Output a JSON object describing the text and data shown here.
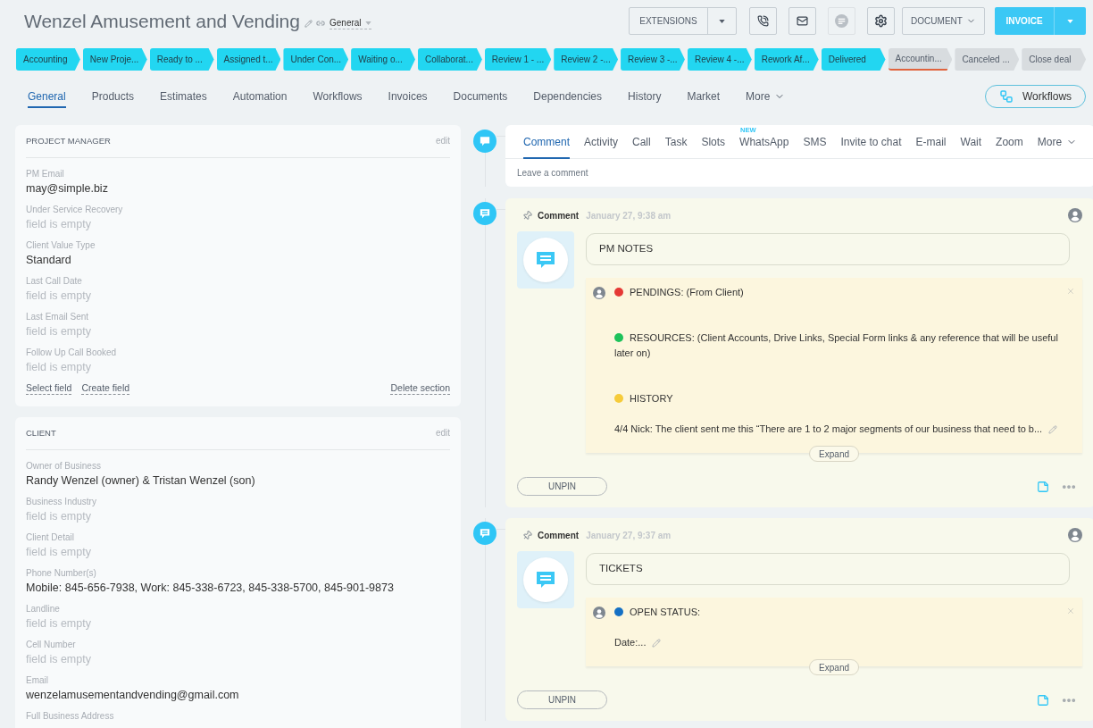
{
  "header": {
    "title": "Wenzel Amusement and Vending",
    "category": "General"
  },
  "toolbar": {
    "extensions": "EXTENSIONS",
    "icon_buttons": [
      {
        "kind": "phone",
        "disabled": false
      },
      {
        "kind": "mail",
        "disabled": false
      },
      {
        "kind": "chat",
        "disabled": true
      },
      {
        "kind": "settings",
        "disabled": false
      }
    ],
    "document": "DOCUMENT",
    "invoice": "INVOICE"
  },
  "stages": [
    {
      "label": "Accounting",
      "reached": true,
      "underlined": false
    },
    {
      "label": "New Proje...",
      "reached": true,
      "underlined": false
    },
    {
      "label": "Ready to ...",
      "reached": true,
      "underlined": false
    },
    {
      "label": "Assigned t...",
      "reached": true,
      "underlined": false
    },
    {
      "label": "Under Con...",
      "reached": true,
      "underlined": false
    },
    {
      "label": "Waiting o...",
      "reached": true,
      "underlined": false
    },
    {
      "label": "Collaborat...",
      "reached": true,
      "underlined": false
    },
    {
      "label": "Review 1 - ...",
      "reached": true,
      "underlined": false
    },
    {
      "label": "Review 2 -...",
      "reached": true,
      "underlined": false
    },
    {
      "label": "Review 3 -...",
      "reached": true,
      "underlined": false
    },
    {
      "label": "Review 4 -...",
      "reached": true,
      "underlined": false
    },
    {
      "label": "Rework Af...",
      "reached": true,
      "underlined": false
    },
    {
      "label": "Delivered",
      "reached": true,
      "underlined": false
    },
    {
      "label": "Accountin...",
      "reached": false,
      "underlined": true
    },
    {
      "label": "Canceled ...",
      "reached": false,
      "underlined": false
    },
    {
      "label": "Close deal",
      "reached": false,
      "underlined": false
    }
  ],
  "nav": {
    "tabs": [
      {
        "label": "General",
        "selected": true
      },
      {
        "label": "Products",
        "selected": false
      },
      {
        "label": "Estimates",
        "selected": false
      },
      {
        "label": "Automation",
        "selected": false
      },
      {
        "label": "Workflows",
        "selected": false
      },
      {
        "label": "Invoices",
        "selected": false
      },
      {
        "label": "Documents",
        "selected": false
      },
      {
        "label": "Dependencies",
        "selected": false
      },
      {
        "label": "History",
        "selected": false
      },
      {
        "label": "Market",
        "selected": false
      }
    ],
    "more": "More",
    "workflows": "Workflows"
  },
  "sections": [
    {
      "title": "PROJECT MANAGER",
      "edit": "edit",
      "fields": [
        {
          "label": "PM Email",
          "value": "may@simple.biz",
          "empty": false
        },
        {
          "label": "Under Service Recovery",
          "value": "field is empty",
          "empty": true
        },
        {
          "label": "Client Value Type",
          "value": "Standard",
          "empty": false
        },
        {
          "label": "Last Call Date",
          "value": "field is empty",
          "empty": true
        },
        {
          "label": "Last Email Sent",
          "value": "field is empty",
          "empty": true
        },
        {
          "label": "Follow Up Call Booked",
          "value": "field is empty",
          "empty": true
        }
      ],
      "footer_links": [
        "Select field",
        "Create field"
      ],
      "delete": "Delete section"
    },
    {
      "title": "CLIENT",
      "edit": "edit",
      "fields": [
        {
          "label": "Owner of Business",
          "value": "Randy Wenzel (owner) & Tristan Wenzel (son)",
          "empty": false
        },
        {
          "label": "Business Industry",
          "value": "field is empty",
          "empty": true
        },
        {
          "label": "Client Detail",
          "value": "field is empty",
          "empty": true
        },
        {
          "label": "Phone Number(s)",
          "value": "Mobile: 845-656-7938, Work: 845-338-6723, 845-338-5700, 845-901-9873",
          "empty": false
        },
        {
          "label": "Landline",
          "value": "field is empty",
          "empty": true
        },
        {
          "label": "Cell Number",
          "value": "field is empty",
          "empty": true
        },
        {
          "label": "Email",
          "value": "wenzelamusementandvending@gmail.com",
          "empty": false
        },
        {
          "label": "Full Business Address"
        }
      ]
    }
  ],
  "composer": {
    "tabs": [
      {
        "label": "Comment",
        "selected": true
      },
      {
        "label": "Activity",
        "selected": false
      },
      {
        "label": "Call",
        "selected": false
      },
      {
        "label": "Task",
        "selected": false
      },
      {
        "label": "Slots",
        "selected": false
      },
      {
        "label": "WhatsApp",
        "selected": false,
        "badge": "NEW"
      },
      {
        "label": "SMS",
        "selected": false
      },
      {
        "label": "Invite to chat",
        "selected": false
      },
      {
        "label": "E-mail",
        "selected": false
      },
      {
        "label": "Wait",
        "selected": false
      },
      {
        "label": "Zoom",
        "selected": false
      }
    ],
    "more": "More",
    "placeholder": "Leave a comment"
  },
  "comments": [
    {
      "type": "Comment",
      "date": "January 27, 9:38 am",
      "pinned": true,
      "title": "PM NOTES",
      "lines": [
        {
          "kind": "heading",
          "color": "#e53935",
          "text": "PENDINGS: (From Client)"
        },
        {
          "kind": "heading",
          "color": "#1dc25b",
          "text": "RESOURCES: (Client Accounts, Drive Links, Special Form links & any reference that will be useful later on)"
        },
        {
          "kind": "heading",
          "color": "#f6cb3a",
          "text": "HISTORY"
        },
        {
          "kind": "text",
          "text": "4/4 Nick: The client sent me this “There are 1 to 2 major segments of our business that need to b..."
        }
      ],
      "expand": "Expand",
      "unpin": "UNPIN"
    },
    {
      "type": "Comment",
      "date": "January 27, 9:37 am",
      "pinned": true,
      "title": "TICKETS",
      "lines": [
        {
          "kind": "heading",
          "color": "#1570c4",
          "text": "OPEN STATUS:"
        },
        {
          "kind": "text",
          "text": "Date:..."
        }
      ],
      "expand": "Expand",
      "unpin": "UNPIN"
    }
  ]
}
